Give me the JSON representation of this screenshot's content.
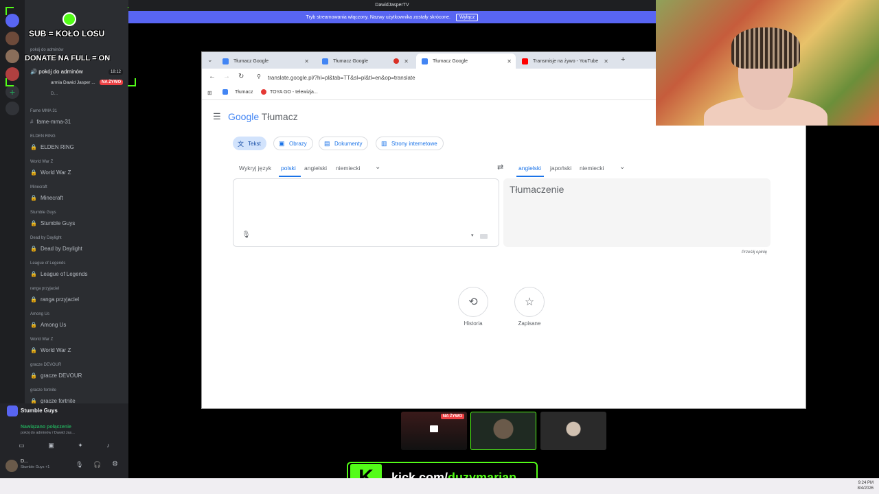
{
  "discord": {
    "server_channel": "Dawid Jasper",
    "overlay_sub": "SUB = KOŁO LOSU",
    "overlay_donate": "DONATE NA FULL = ON",
    "active_voice_category": "pokój do adminów",
    "active_voice": "pokój do adminów",
    "active_voice_time": "18:12",
    "live_user": "armia Dawid Jasper ...",
    "live_badge": "NA ŻYWO",
    "second_user": "D...",
    "channels": [
      {
        "cat": "Fame MMA 31",
        "name": "fame-mma-31",
        "type": "text"
      },
      {
        "cat": "ELDEN RING",
        "name": "ELDEN RING",
        "type": "voice"
      },
      {
        "cat": "World War Z",
        "name": "World War Z",
        "type": "voice"
      },
      {
        "cat": "Minecraft",
        "name": "Minecraft",
        "type": "voice"
      },
      {
        "cat": "Stumble Guys",
        "name": "Stumble Guys",
        "type": "voice"
      },
      {
        "cat": "Dead by Daylight",
        "name": "Dead by Daylight",
        "type": "voice"
      },
      {
        "cat": "League of Legends",
        "name": "League of Legends",
        "type": "voice"
      },
      {
        "cat": "ranga przyjaciel",
        "name": "ranga przyjaciel",
        "type": "voice"
      },
      {
        "cat": "Among Us",
        "name": "Among Us",
        "type": "voice"
      },
      {
        "cat": "World War Z",
        "name": "World War Z",
        "type": "voice"
      },
      {
        "cat": "gracze DEVOUR",
        "name": "gracze DEVOUR",
        "type": "voice"
      },
      {
        "cat": "gracze fortnite",
        "name": "gracze fortnite",
        "type": "voice"
      }
    ],
    "panel_channel": "Stumble Guys",
    "connection_status": "Nawiązano połączenie",
    "connection_detail": "pokój do adminów / Dawid Jas...",
    "username": "D...",
    "user_status": "Stumble Guys +1"
  },
  "title_bar": "DawidJasperTV",
  "stream_banner": {
    "text": "Tryb streamowania włączony. Nazwy użytkownika zostały skrócone.",
    "button": "Wyłącz"
  },
  "chrome": {
    "tabs": [
      "Tłumacz Google",
      "Tłumacz Google",
      "Tłumacz Google",
      "Transmisje na żywo - YouTube"
    ],
    "url": "translate.google.pl/?hl=pl&tab=TT&sl=pl&tl=en&op=translate",
    "bookmarks": [
      "Tłumacz",
      "TOYA GO - telewizja..."
    ]
  },
  "translate": {
    "logo_google": "Google",
    "logo_product": "Tłumacz",
    "modes": [
      "Tekst",
      "Obrazy",
      "Dokumenty",
      "Strony internetowe"
    ],
    "source_langs": [
      "Wykryj język",
      "polski",
      "angielski",
      "niemiecki"
    ],
    "target_langs": [
      "angielski",
      "japoński",
      "niemiecki"
    ],
    "target_placeholder": "Tłumaczenie",
    "feedback": "Prześlij opinię",
    "history": "Historia",
    "saved": "Zapisane"
  },
  "stream": {
    "thumb_live_badge": "NA ŻYWO",
    "kick_url_prefix": "kick.com/",
    "kick_url_name": "duzymarian"
  },
  "tray": {
    "time": "9:24 PM",
    "date": "8/4/2026"
  }
}
